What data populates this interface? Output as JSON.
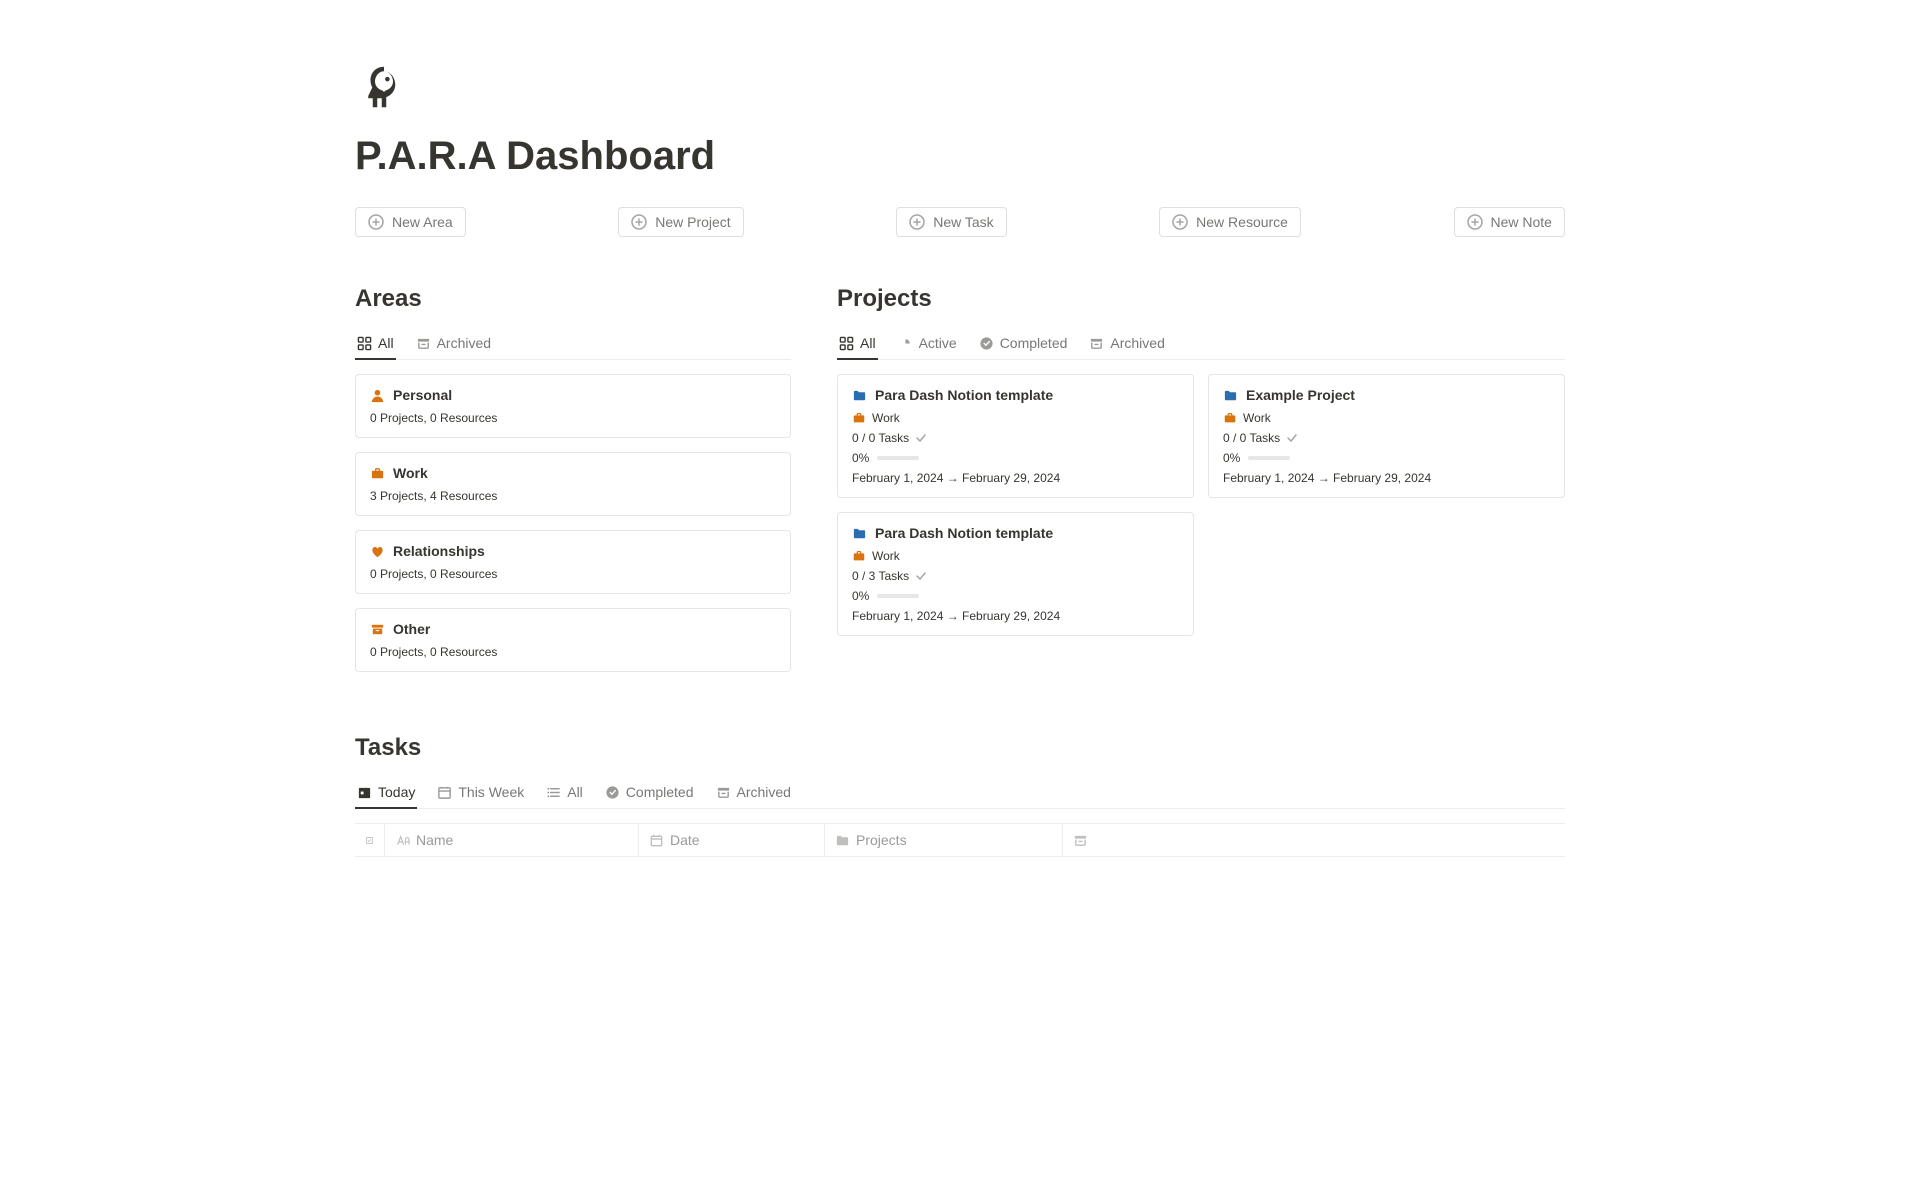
{
  "page": {
    "title": "P.A.R.A Dashboard"
  },
  "actions": {
    "new_area": "New Area",
    "new_project": "New Project",
    "new_task": "New Task",
    "new_resource": "New Resource",
    "new_note": "New Note"
  },
  "areas": {
    "title": "Areas",
    "tabs": {
      "all": "All",
      "archived": "Archived"
    },
    "items": [
      {
        "name": "Personal",
        "sub": "0 Projects, 0 Resources",
        "icon": "person",
        "color": "#d9730d"
      },
      {
        "name": "Work",
        "sub": "3 Projects, 4 Resources",
        "icon": "briefcase",
        "color": "#d9730d"
      },
      {
        "name": "Relationships",
        "sub": "0 Projects, 0 Resources",
        "icon": "heart",
        "color": "#d9730d"
      },
      {
        "name": "Other",
        "sub": "0 Projects, 0 Resources",
        "icon": "archive",
        "color": "#d9730d"
      }
    ]
  },
  "projects": {
    "title": "Projects",
    "tabs": {
      "all": "All",
      "active": "Active",
      "completed": "Completed",
      "archived": "Archived"
    },
    "items": [
      {
        "name": "Para Dash Notion template",
        "area": "Work",
        "tasks": "0 / 0 Tasks",
        "pct": "0%",
        "date": "February 1, 2024 → February 29, 2024"
      },
      {
        "name": "Example Project",
        "area": "Work",
        "tasks": "0 / 0 Tasks",
        "pct": "0%",
        "date": "February 1, 2024 → February 29, 2024"
      },
      {
        "name": "Para Dash Notion template",
        "area": "Work",
        "tasks": "0 / 3 Tasks",
        "pct": "0%",
        "date": "February 1, 2024 → February 29, 2024"
      }
    ]
  },
  "tasks": {
    "title": "Tasks",
    "tabs": {
      "today": "Today",
      "this_week": "This Week",
      "all": "All",
      "completed": "Completed",
      "archived": "Archived"
    },
    "columns": {
      "name": "Name",
      "date": "Date",
      "projects": "Projects"
    }
  }
}
